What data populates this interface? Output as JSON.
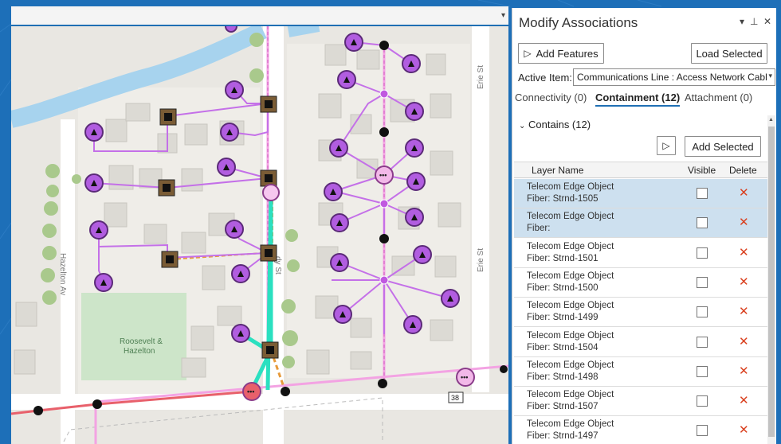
{
  "window": {
    "dock_arrow": "▾"
  },
  "panel": {
    "title": "Modify Associations",
    "pin_icon": "pin-icon",
    "close_icon": "close-icon",
    "add_features_label": "Add Features",
    "load_selected_label": "Load Selected",
    "active_item_label": "Active Item:",
    "active_item_value": "Communications Line : Access Network Cable",
    "tabs": [
      "Connectivity (0)",
      "Containment (12)",
      "Attachment (0)"
    ],
    "active_tab": 1,
    "section_label": "Contains (12)",
    "add_selected_label": "Add Selected",
    "columns": {
      "layer": "Layer Name",
      "visible": "Visible",
      "delete": "Delete"
    },
    "rows": [
      {
        "line1": "Telecom Edge Object",
        "line2": "Fiber: Strnd-1505",
        "selected": true
      },
      {
        "line1": "Telecom Edge Object",
        "line2": "Fiber:",
        "selected": true
      },
      {
        "line1": "Telecom Edge Object",
        "line2": "Fiber: Strnd-1501",
        "selected": false
      },
      {
        "line1": "Telecom Edge Object",
        "line2": "Fiber: Strnd-1500",
        "selected": false
      },
      {
        "line1": "Telecom Edge Object",
        "line2": "Fiber: Strnd-1499",
        "selected": false
      },
      {
        "line1": "Telecom Edge Object",
        "line2": "Fiber: Strnd-1504",
        "selected": false
      },
      {
        "line1": "Telecom Edge Object",
        "line2": "Fiber: Strnd-1498",
        "selected": false
      },
      {
        "line1": "Telecom Edge Object",
        "line2": "Fiber: Strnd-1507",
        "selected": false
      },
      {
        "line1": "Telecom Edge Object",
        "line2": "Fiber: Strnd-1497",
        "selected": false
      }
    ]
  },
  "map": {
    "labels": {
      "erie_st_top": "Erie St",
      "erie_st_mid": "Erie St",
      "hazelton_av": "Hazelton Av",
      "park_line1": "Roosevelt &",
      "park_line2": "Hazelton",
      "street_partial": "dy St",
      "route_shield": "38"
    },
    "colors": {
      "purple": "#b15de0",
      "teal": "#2be0c0",
      "pink": "#f18ad8",
      "red": "#e8606b",
      "water": "#a7d3ee",
      "park": "#cde5c9"
    }
  }
}
